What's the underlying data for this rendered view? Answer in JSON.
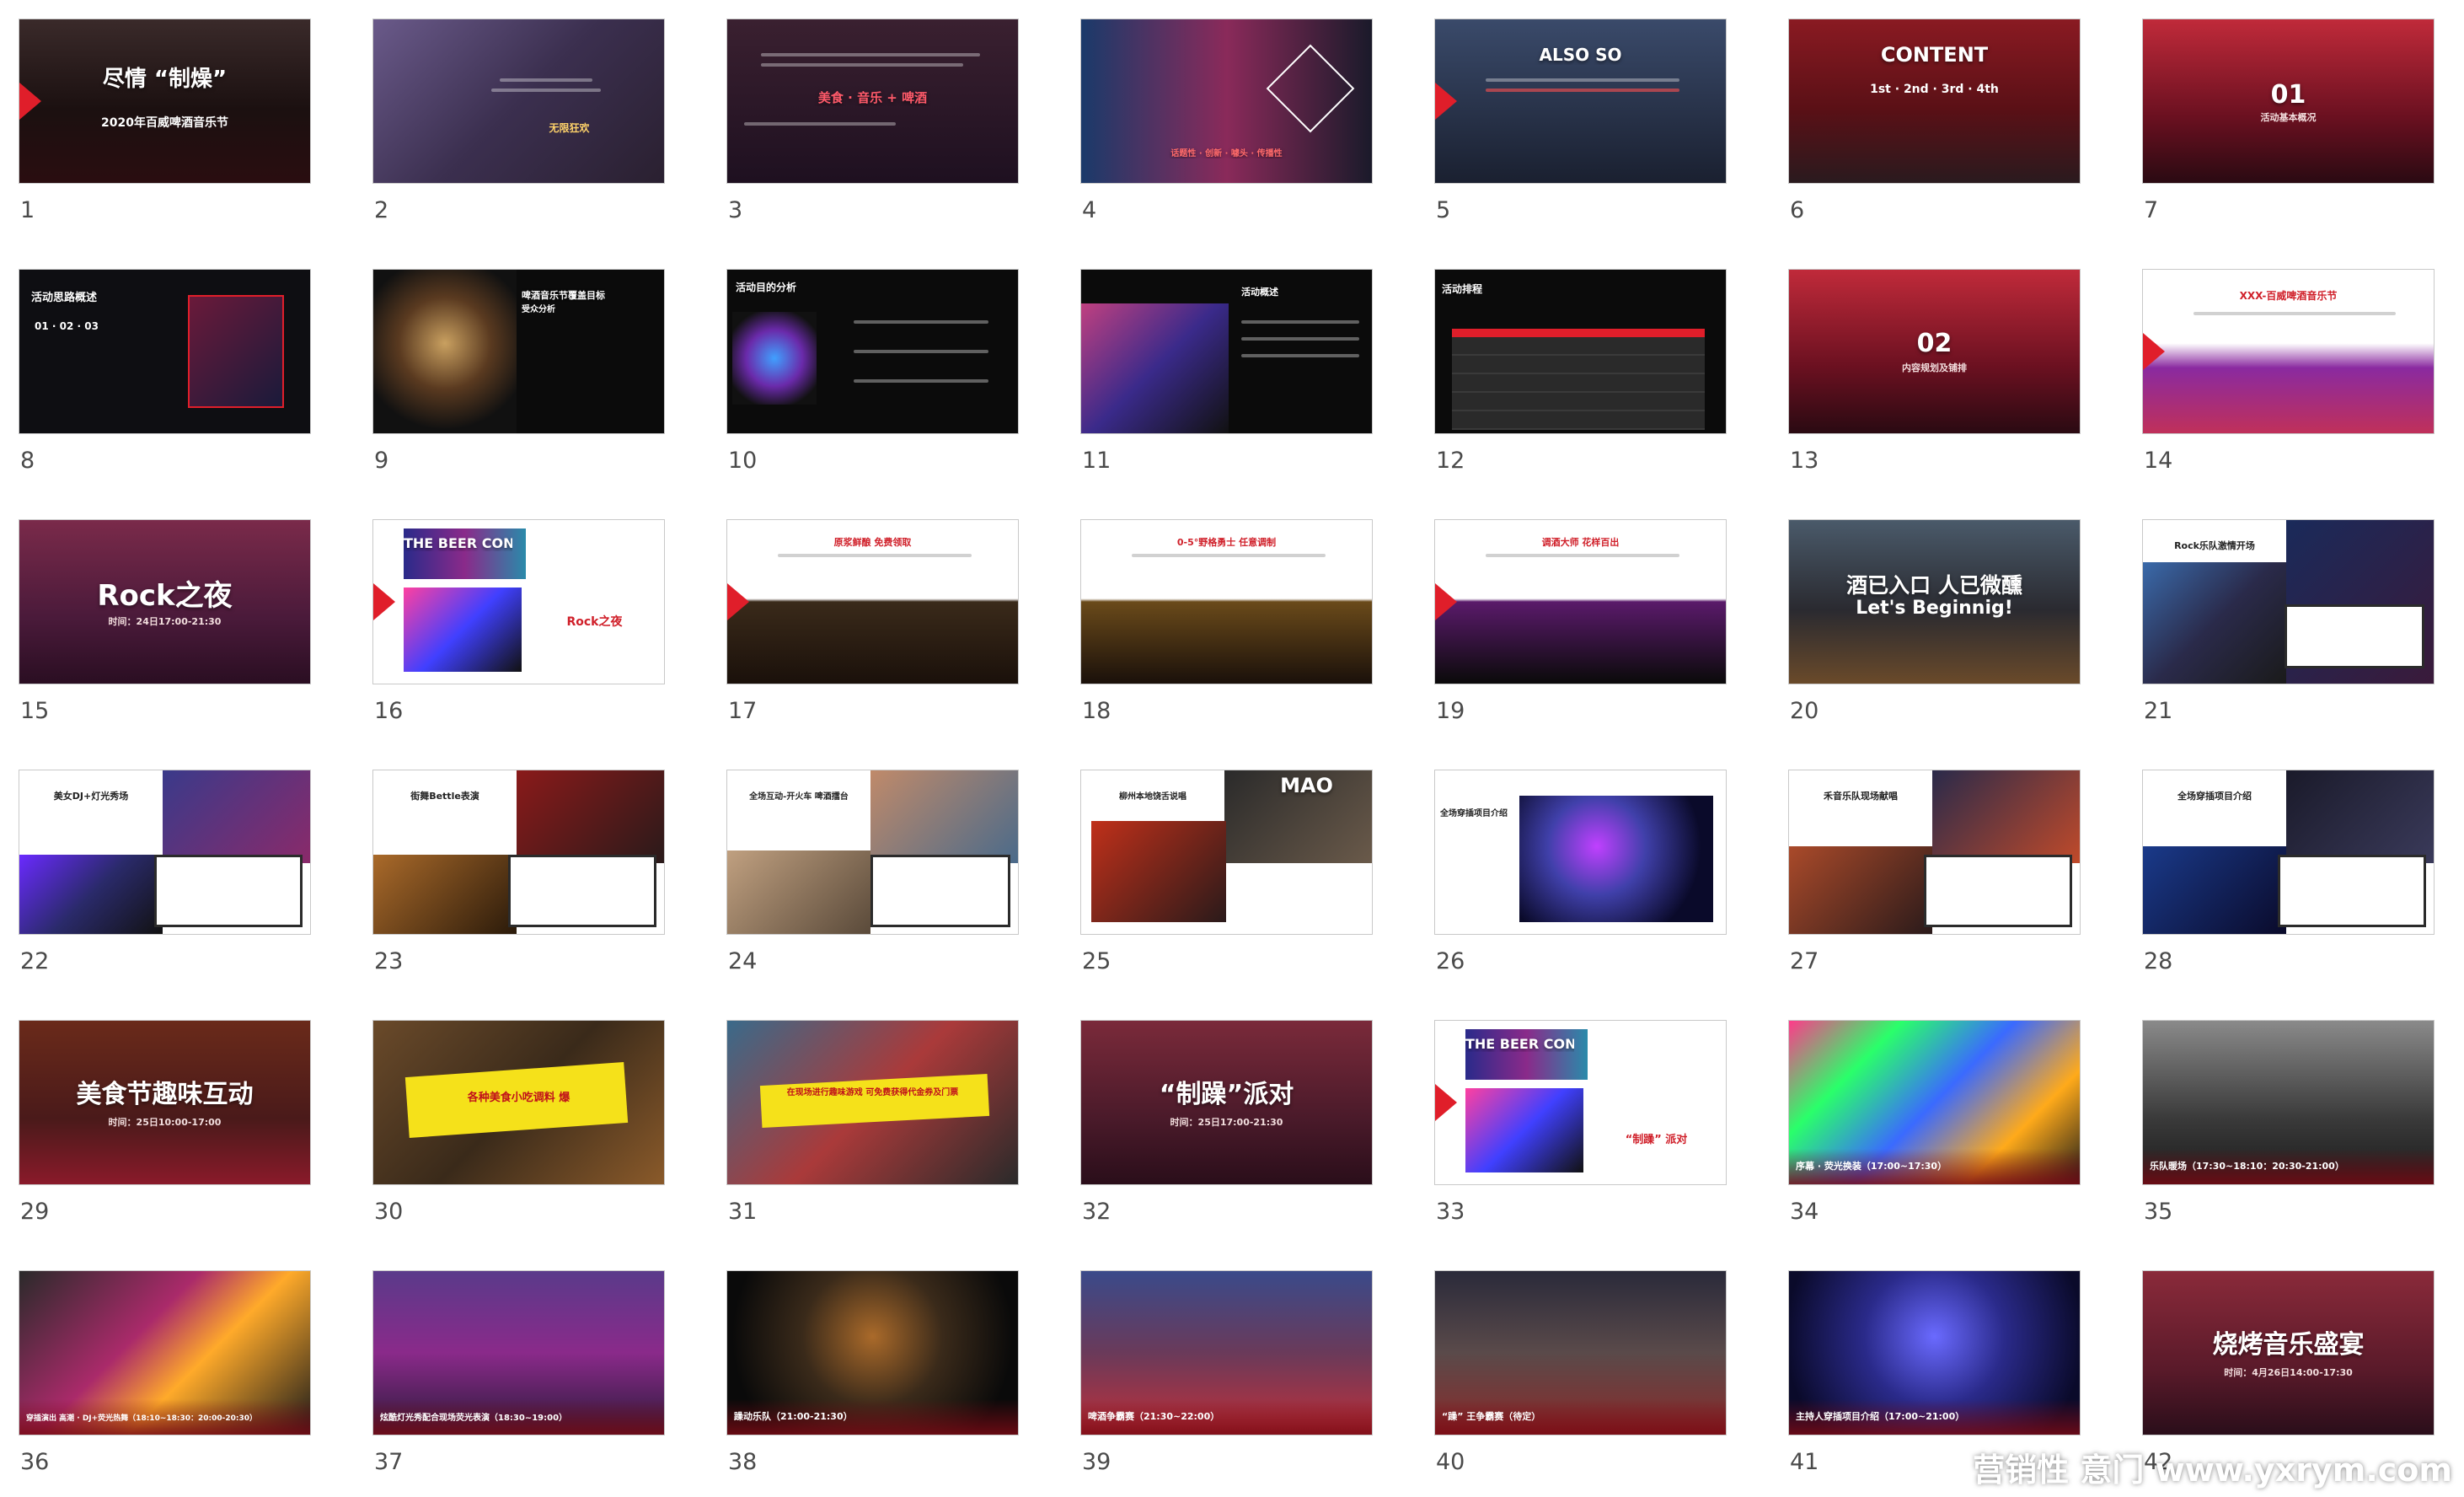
{
  "slides": [
    {
      "num": "1",
      "title": "尽情 “制燥”",
      "subtitle": "2020年百威啤酒音乐节"
    },
    {
      "num": "2",
      "title": "",
      "subtitle": "无限狂欢"
    },
    {
      "num": "3",
      "title": "美食 · 音乐 + 啤酒",
      "subtitle": ""
    },
    {
      "num": "4",
      "title": "话题性 · 创新 · 噱头 · 传播性",
      "subtitle": ""
    },
    {
      "num": "5",
      "title": "ALSO SO",
      "subtitle": ""
    },
    {
      "num": "6",
      "title": "CONTENT",
      "subtitle": "1st · 2nd · 3rd · 4th"
    },
    {
      "num": "7",
      "title": "01",
      "subtitle": "活动基本概况"
    },
    {
      "num": "8",
      "title": "活动思路概述",
      "subtitle": "01 · 02 · 03"
    },
    {
      "num": "9",
      "title": "啤酒音乐节覆盖目标",
      "subtitle": "受众分析"
    },
    {
      "num": "10",
      "title": "活动目的分析",
      "subtitle": ""
    },
    {
      "num": "11",
      "title": "活动概述",
      "subtitle": ""
    },
    {
      "num": "12",
      "title": "活动排程",
      "subtitle": ""
    },
    {
      "num": "13",
      "title": "02",
      "subtitle": "内容规划及铺排"
    },
    {
      "num": "14",
      "title": "XXX-百威啤酒音乐节",
      "subtitle": ""
    },
    {
      "num": "15",
      "title": "Rock之夜",
      "subtitle": "时间：24日17:00-21:30"
    },
    {
      "num": "16",
      "title": "THE BEER CONTAINER",
      "subtitle": "Rock之夜"
    },
    {
      "num": "17",
      "title": "原浆鲜酿 免费领取",
      "subtitle": ""
    },
    {
      "num": "18",
      "title": "0-5°野格勇士 任意调制",
      "subtitle": ""
    },
    {
      "num": "19",
      "title": "调酒大师 花样百出",
      "subtitle": ""
    },
    {
      "num": "20",
      "title": "酒已入口 人已微醺",
      "subtitle": "Let's Beginnig!"
    },
    {
      "num": "21",
      "title": "Rock乐队激情开场",
      "subtitle": ""
    },
    {
      "num": "22",
      "title": "美女DJ+灯光秀场",
      "subtitle": ""
    },
    {
      "num": "23",
      "title": "街舞Bettle表演",
      "subtitle": ""
    },
    {
      "num": "24",
      "title": "全场互动-开火车 啤酒擂台",
      "subtitle": ""
    },
    {
      "num": "25",
      "title": "柳州本地饶舌说唱",
      "subtitle": "MAO"
    },
    {
      "num": "26",
      "title": "全场穿插项目介绍",
      "subtitle": ""
    },
    {
      "num": "27",
      "title": "禾音乐队现场献唱",
      "subtitle": ""
    },
    {
      "num": "28",
      "title": "全场穿插项目介绍",
      "subtitle": ""
    },
    {
      "num": "29",
      "title": "美食节趣味互动",
      "subtitle": "时间：25日10:00-17:00"
    },
    {
      "num": "30",
      "title": "各种美食小吃调料 爆",
      "subtitle": ""
    },
    {
      "num": "31",
      "title": "在现场进行趣味游戏 可免费获得代金券及门票",
      "subtitle": ""
    },
    {
      "num": "32",
      "title": "“制躁”派对",
      "subtitle": "时间：25日17:00-21:30"
    },
    {
      "num": "33",
      "title": "THE BEER CONTAINER",
      "subtitle": "“制躁” 派对"
    },
    {
      "num": "34",
      "title": "",
      "subtitle": "序幕 · 荧光换装（17:00~17:30）"
    },
    {
      "num": "35",
      "title": "",
      "subtitle": "乐队暖场（17:30~18:10：20:30-21:00）"
    },
    {
      "num": "36",
      "title": "",
      "subtitle": "穿插演出 高潮 · DJ+荧光热舞（18:10~18:30：20:00-20:30）"
    },
    {
      "num": "37",
      "title": "",
      "subtitle": "炫酷灯光秀配合现场荧光表演（18:30~19:00）"
    },
    {
      "num": "38",
      "title": "",
      "subtitle": "躁动乐队（21:00-21:30）"
    },
    {
      "num": "39",
      "title": "",
      "subtitle": "啤酒争霸赛（21:30~22:00）"
    },
    {
      "num": "40",
      "title": "",
      "subtitle": "“躁” 王争霸赛（待定）"
    },
    {
      "num": "41",
      "title": "",
      "subtitle": "主持人穿插项目介绍（17:00~21:00）"
    },
    {
      "num": "42",
      "title": "烧烤音乐盛宴",
      "subtitle": "时间：4月26日14:00-17:30"
    }
  ],
  "watermark": "营销性 意门 www.yxrym.com",
  "colors": {
    "accent": "#e01e2a",
    "background": "#ffffff",
    "number": "#4a4a4a"
  }
}
